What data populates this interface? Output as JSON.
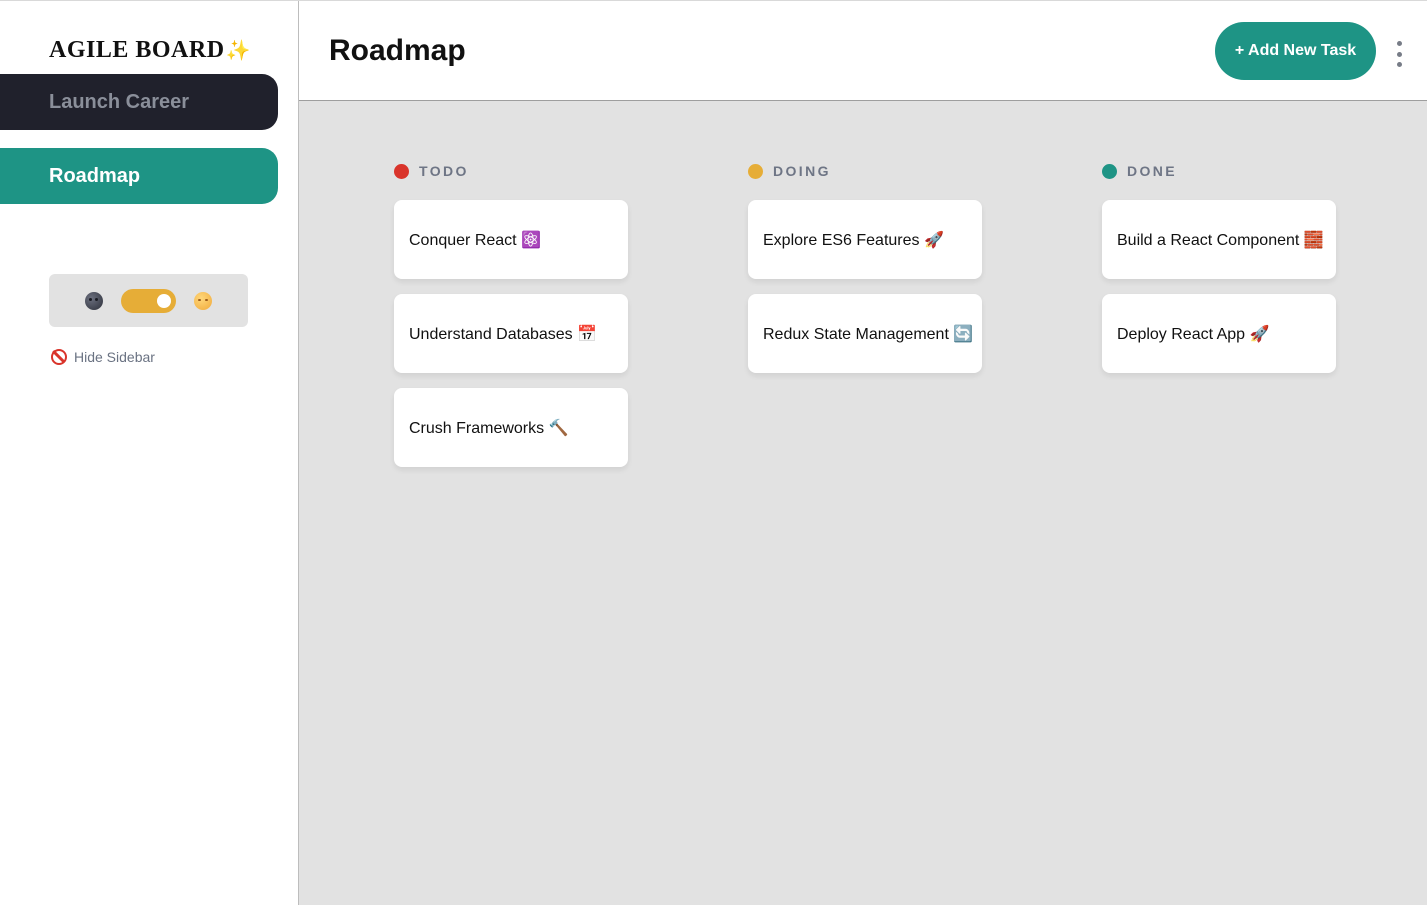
{
  "sidebar": {
    "logo": "AGILE BOARD",
    "logo_sparkle": "✨",
    "boards": [
      {
        "label": "Launch Career"
      },
      {
        "label": "Roadmap"
      }
    ],
    "theme_toggle": {
      "left_icon": "moon-icon",
      "right_icon": "sun-icon",
      "state": "light"
    },
    "hide_sidebar_label": "Hide Sidebar"
  },
  "header": {
    "title": "Roadmap",
    "add_task_label": "+ Add New Task"
  },
  "columns": [
    {
      "name": "TODO",
      "color": "#d9342b",
      "tasks": [
        "Conquer React ⚛️",
        "Understand Databases 📅",
        "Crush Frameworks 🔨"
      ]
    },
    {
      "name": "DOING",
      "color": "#e6ad37",
      "tasks": [
        "Explore ES6 Features 🚀",
        "Redux State Management 🔄"
      ]
    },
    {
      "name": "DONE",
      "color": "#1e9485",
      "tasks": [
        "Build a React Component 🧱",
        "Deploy React App 🚀"
      ]
    }
  ],
  "colors": {
    "accent": "#1e9485",
    "dark_board": "#20212c",
    "board_bg": "#e2e2e2"
  }
}
